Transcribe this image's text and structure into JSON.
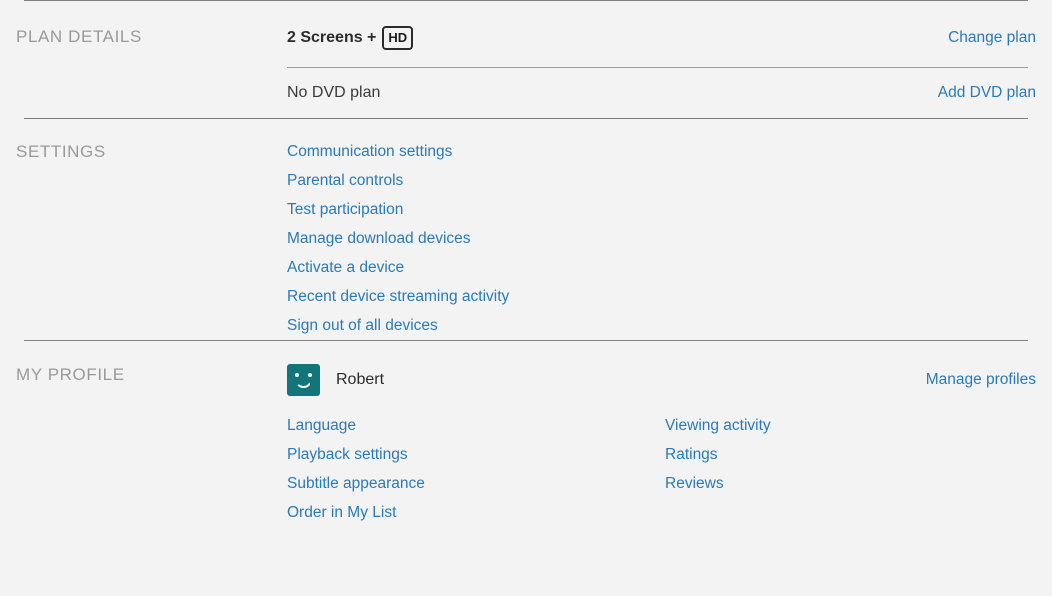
{
  "theme": {
    "background": "#f3f3f3",
    "link_color": "#2a7ab9",
    "label_color": "#999999",
    "text_color": "#2b2b2b",
    "avatar_color": "#11757a",
    "divider_color": "#808080"
  },
  "plan_details": {
    "label": "PLAN DETAILS",
    "plan_name": "2 Screens +",
    "quality_badge": "HD",
    "change_plan_link": "Change plan",
    "dvd_status": "No DVD plan",
    "add_dvd_link": "Add DVD plan"
  },
  "settings": {
    "label": "SETTINGS",
    "links": [
      "Communication settings",
      "Parental controls",
      "Test participation",
      "Manage download devices",
      "Activate a device",
      "Recent device streaming activity",
      "Sign out of all devices"
    ]
  },
  "my_profile": {
    "label": "MY PROFILE",
    "profile_name": "Robert",
    "avatar_icon": "smiley-avatar-icon",
    "manage_profiles_link": "Manage profiles",
    "left_links": [
      "Language",
      "Playback settings",
      "Subtitle appearance",
      "Order in My List"
    ],
    "right_links": [
      "Viewing activity",
      "Ratings",
      "Reviews"
    ]
  }
}
